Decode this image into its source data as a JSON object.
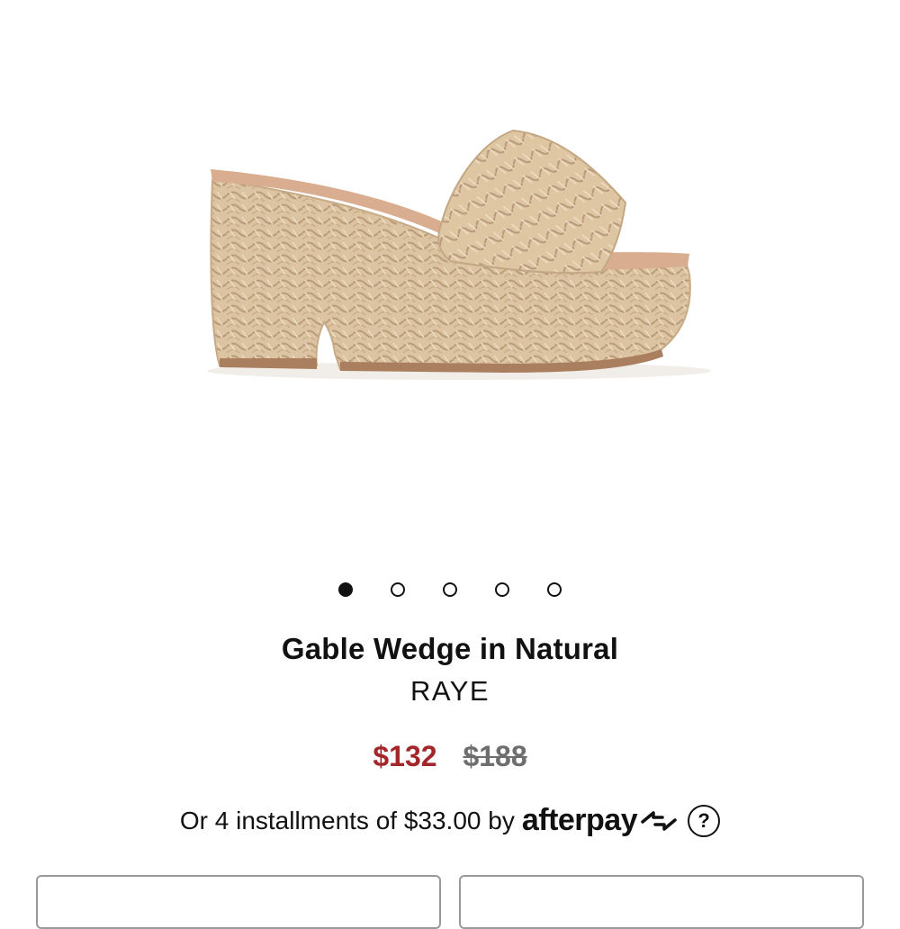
{
  "product": {
    "title": "Gable Wedge in Natural",
    "brand": "RAYE",
    "sale_price": "$132",
    "original_price": "$188",
    "image_icon": "raffia-wedge-sandal-image"
  },
  "carousel": {
    "total": 5,
    "active_index": 0
  },
  "afterpay": {
    "text": "Or 4 installments of $33.00 by",
    "logo": "afterpay",
    "help": "?"
  },
  "colors": {
    "sale_price": "#a3272a",
    "original_price": "#6e6e6e",
    "raffia": "#dcc3a1",
    "footbed": "#d9ad8f"
  }
}
